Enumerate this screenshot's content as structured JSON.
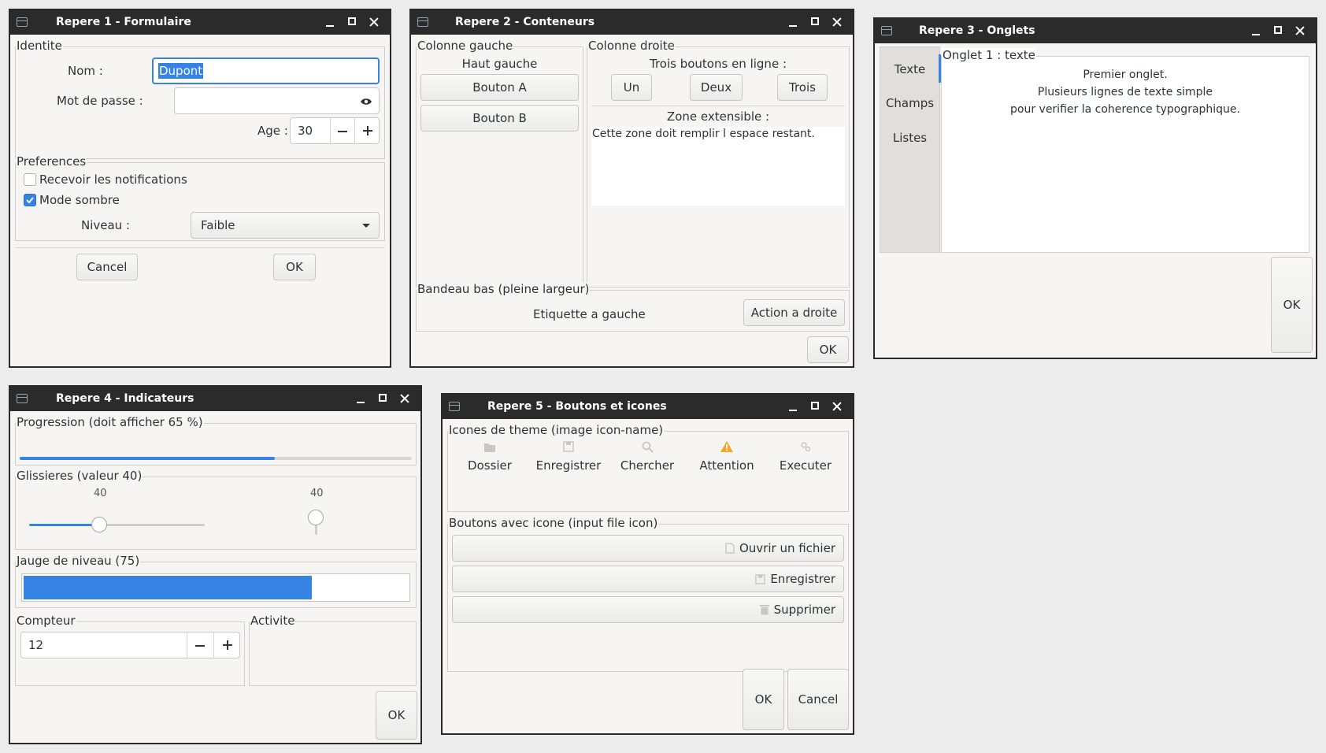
{
  "colors": {
    "accent": "#3584e4",
    "titlebar": "#2b2b2b",
    "window_bg": "#f6f5f4",
    "warning": "#f5a623"
  },
  "win1": {
    "title": "Repere 1 - Formulaire",
    "identite": {
      "legend": "Identite",
      "nom_label": "Nom :",
      "nom_value": "Dupont",
      "mdp_label": "Mot de passe :",
      "age_label": "Age :",
      "age_value": "30"
    },
    "preferences": {
      "legend": "Preferences",
      "notif_label": "Recevoir les notifications",
      "notif_checked": false,
      "sombre_label": "Mode sombre",
      "sombre_checked": true,
      "niveau_label": "Niveau :",
      "niveau_value": "Faible"
    },
    "cancel": "Cancel",
    "ok": "OK"
  },
  "win2": {
    "title": "Repere 2 - Conteneurs",
    "left": {
      "legend": "Colonne gauche",
      "heading": "Haut gauche",
      "btn_a": "Bouton A",
      "btn_b": "Bouton B"
    },
    "right": {
      "legend": "Colonne droite",
      "heading": "Trois boutons en ligne :",
      "b1": "Un",
      "b2": "Deux",
      "b3": "Trois",
      "zone_label": "Zone extensible :",
      "zone_text": "Cette zone doit remplir l espace restant."
    },
    "bottom": {
      "legend": "Bandeau bas (pleine largeur)",
      "label": "Etiquette a gauche",
      "action": "Action a droite"
    },
    "ok": "OK"
  },
  "win3": {
    "title": "Repere 3 - Onglets",
    "tabs": [
      "Texte",
      "Champs",
      "Listes"
    ],
    "active_tab": "Texte",
    "page": {
      "legend": "Onglet 1 : texte",
      "lines": [
        "Premier onglet.",
        "Plusieurs lignes de texte simple",
        "pour verifier la coherence typographique."
      ]
    },
    "ok": "OK"
  },
  "win4": {
    "title": "Repere 4 - Indicateurs",
    "progression": {
      "legend": "Progression (doit afficher 65 %)",
      "value": 65
    },
    "sliders": {
      "legend": "Glissieres (valeur 40)",
      "h_value": "40",
      "v_value": "40",
      "level": 40
    },
    "jauge": {
      "legend": "Jauge de niveau (75)",
      "value": 75
    },
    "compteur": {
      "legend": "Compteur",
      "value": "12"
    },
    "activite": {
      "legend": "Activite"
    },
    "ok": "OK"
  },
  "win5": {
    "title": "Repere 5 - Boutons et icones",
    "icons_legend": "Icones de theme (image icon-name)",
    "icons": [
      {
        "label": "Dossier",
        "icon": "folder-icon"
      },
      {
        "label": "Enregistrer",
        "icon": "save-icon"
      },
      {
        "label": "Chercher",
        "icon": "search-icon"
      },
      {
        "label": "Attention",
        "icon": "warning-icon"
      },
      {
        "label": "Executer",
        "icon": "execute-icon"
      }
    ],
    "buttons_legend": "Boutons avec icone (input file icon)",
    "buttons": [
      {
        "label": "Ouvrir un fichier",
        "icon": "file-icon"
      },
      {
        "label": "Enregistrer",
        "icon": "save-icon"
      },
      {
        "label": "Supprimer",
        "icon": "trash-icon"
      }
    ],
    "ok": "OK",
    "cancel": "Cancel"
  }
}
